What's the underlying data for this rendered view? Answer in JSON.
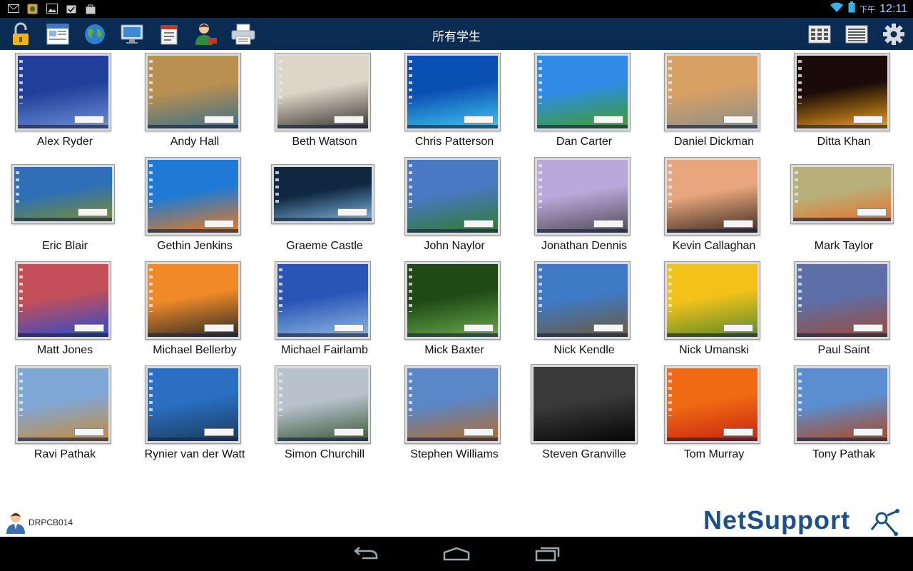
{
  "status_bar": {
    "ampm": "下午",
    "time": "12:11",
    "left_icons": [
      "gmail-icon",
      "notification-app-icon",
      "image-icon",
      "task-icon",
      "shopping-bag-icon"
    ]
  },
  "toolbar": {
    "title": "所有学生",
    "left_buttons": [
      "lock-icon",
      "browser-window-icon",
      "globe-icon",
      "monitor-icon",
      "clipboard-icon",
      "user-message-icon",
      "printer-icon"
    ],
    "right_buttons": [
      "thumbnail-grid-icon",
      "list-view-icon",
      "gear-icon"
    ]
  },
  "students": [
    {
      "name": "Alex Ryder",
      "wallpaper": [
        "#1f3f9a",
        "#6f8fd6"
      ]
    },
    {
      "name": "Andy Hall",
      "wallpaper": [
        "#b99050",
        "#3b6f8a"
      ]
    },
    {
      "name": "Beth Watson",
      "wallpaper": [
        "#dcd6c8",
        "#3a3531"
      ]
    },
    {
      "name": "Chris Patterson",
      "wallpaper": [
        "#0a4fb3",
        "#41c7ee"
      ]
    },
    {
      "name": "Dan Carter",
      "wallpaper": [
        "#2f8be6",
        "#3f9f25"
      ]
    },
    {
      "name": "Daniel Dickman",
      "wallpaper": [
        "#d9a063",
        "#8a8f8c"
      ]
    },
    {
      "name": "Ditta Khan",
      "wallpaper": [
        "#1a0b08",
        "#f1a11a"
      ]
    },
    {
      "name": "Eric Blair",
      "wallpaper": [
        "#2e6fb7",
        "#7c8f2a"
      ]
    },
    {
      "name": "Gethin Jenkins",
      "wallpaper": [
        "#1e7ad6",
        "#ef7a18"
      ]
    },
    {
      "name": "Graeme Castle",
      "wallpaper": [
        "#0f2740",
        "#7fb6e0"
      ]
    },
    {
      "name": "John Naylor",
      "wallpaper": [
        "#4a78c2",
        "#2e7b2b"
      ]
    },
    {
      "name": "Jonathan Dennis",
      "wallpaper": [
        "#b9a8d9",
        "#4f4b55"
      ]
    },
    {
      "name": "Kevin Callaghan",
      "wallpaper": [
        "#e7a67c",
        "#3b2a22"
      ]
    },
    {
      "name": "Mark Taylor",
      "wallpaper": [
        "#b8b07a",
        "#e6712a"
      ]
    },
    {
      "name": "Matt Jones",
      "wallpaper": [
        "#c24f5a",
        "#2a4bd0"
      ]
    },
    {
      "name": "Michael Bellerby",
      "wallpaper": [
        "#f08a28",
        "#2d2a26"
      ]
    },
    {
      "name": "Michael Fairlamb",
      "wallpaper": [
        "#2a55b6",
        "#8fb9e0"
      ]
    },
    {
      "name": "Mick Baxter",
      "wallpaper": [
        "#1f4a16",
        "#6aa94a"
      ]
    },
    {
      "name": "Nick Kendle",
      "wallpaper": [
        "#3f7ac7",
        "#6b5a3a"
      ]
    },
    {
      "name": "Nick Umanski",
      "wallpaper": [
        "#f2c21b",
        "#5a8a2a"
      ]
    },
    {
      "name": "Paul Saint",
      "wallpaper": [
        "#5c6fa8",
        "#9e4b3a"
      ]
    },
    {
      "name": "Ravi Pathak",
      "wallpaper": [
        "#7fa7d6",
        "#c98a3a"
      ]
    },
    {
      "name": "Rynier van der Watt",
      "wallpaper": [
        "#2a6fc2",
        "#1c3a5a"
      ]
    },
    {
      "name": "Simon Churchill",
      "wallpaper": [
        "#b8c2cc",
        "#3b5a3a"
      ]
    },
    {
      "name": "Stephen Williams",
      "wallpaper": [
        "#5a87c7",
        "#b56a2a"
      ]
    },
    {
      "name": "Steven Granville",
      "wallpaper": [
        "#3a3a3a",
        "#050505"
      ]
    },
    {
      "name": "Tom Murray",
      "wallpaper": [
        "#f06a14",
        "#c8230f"
      ]
    },
    {
      "name": "Tony Pathak",
      "wallpaper": [
        "#5b8ed0",
        "#b0461e"
      ]
    }
  ],
  "footer": {
    "user_id": "DRPCB014",
    "logo_text": "NetSupport"
  },
  "colors": {
    "toolbar_bg": "#0b2c52",
    "logo_blue": "#1d4f8c"
  }
}
